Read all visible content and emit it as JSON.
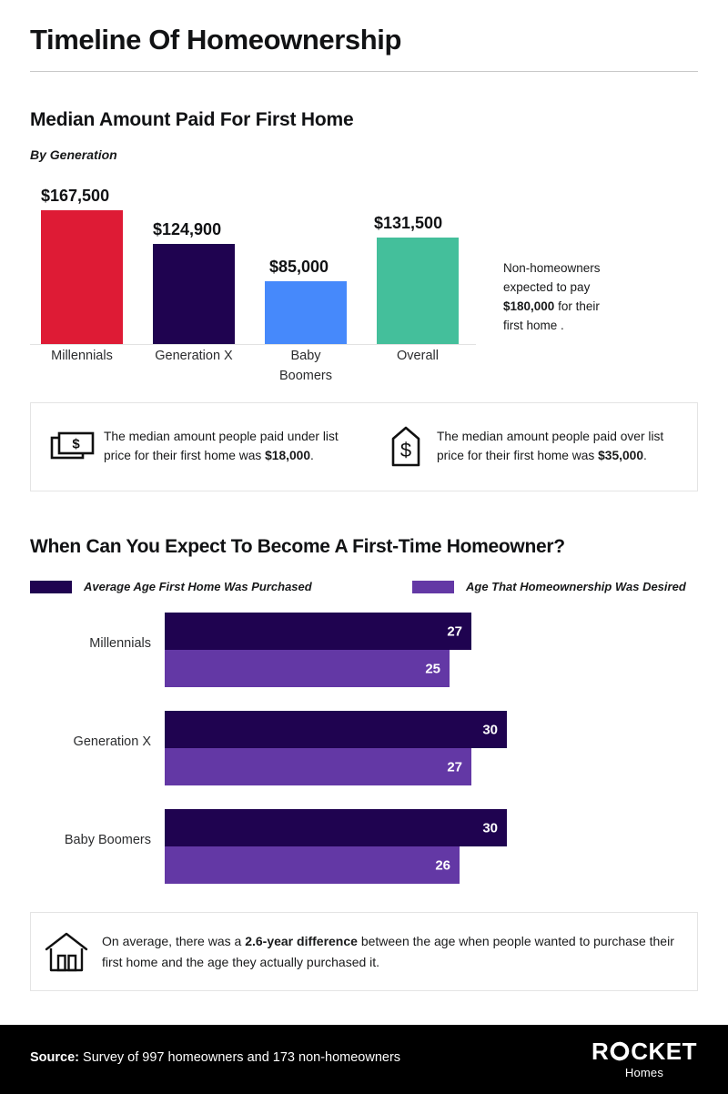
{
  "header": {
    "title": "Timeline Of Homeownership"
  },
  "section1": {
    "title": "Median Amount Paid For First Home",
    "subtitle": "By Generation",
    "side_note": {
      "line1": "Non-homeowners",
      "line2": "expected to pay",
      "amount": "$180,000",
      "line3": " for their",
      "line4": "first home ."
    }
  },
  "info_boxes": [
    {
      "icon": "cash-icon",
      "text_before": "The median amount people paid under list price for their first home was ",
      "amount": "$18,000",
      "text_after": "."
    },
    {
      "icon": "price-tag-icon",
      "text_before": "The median amount people paid over list price for their first home was ",
      "amount": "$35,000",
      "text_after": "."
    }
  ],
  "section2": {
    "title": "When Can You Expect To Become A First-Time Homeowner?"
  },
  "bottom_note": {
    "icon": "house-icon",
    "text_before": "On average, there was a ",
    "highlight": "2.6-year difference",
    "text_after": " between the age when people wanted to purchase their first home and the age they actually purchased it."
  },
  "footer": {
    "source_label": "Source:",
    "source_text": " Survey of 997 homeowners and 173 non-homeowners",
    "logo_main": "ROCKET",
    "logo_sub": "Homes"
  },
  "colors": {
    "red": "#DE1B35",
    "dark_purple": "#1F0350",
    "blue": "#4689FB",
    "teal": "#44BF9B",
    "mid_purple": "#6338A5",
    "black": "#000000",
    "rule": "#c9c9c9",
    "box_border": "#e4e4e4"
  },
  "chart_data": [
    {
      "type": "bar",
      "title": "Median Amount Paid For First Home",
      "subtitle": "By Generation",
      "xlabel": "",
      "ylabel": "",
      "ylim": [
        0,
        185000
      ],
      "grid": false,
      "legend": "none",
      "categories": [
        "Millennials",
        "Generation X",
        "Baby Boomers",
        "Overall"
      ],
      "values": [
        167500,
        124900,
        85000,
        131500
      ],
      "value_labels": [
        "$167,500",
        "$124,900",
        "$85,000",
        "$131,500"
      ],
      "bar_colors": [
        "#DE1B35",
        "#1F0350",
        "#4689FB",
        "#44BF9B"
      ],
      "annotation": "Non-homeowners expected to pay $180,000 for their first home ."
    },
    {
      "type": "bar",
      "orientation": "horizontal",
      "title": "When Can You Expect To Become A First-Time Homeowner?",
      "xlabel": "",
      "ylabel": "",
      "xlim": [
        0,
        34
      ],
      "grid": false,
      "legend": "top",
      "categories": [
        "Millennials",
        "Generation X",
        "Baby Boomers"
      ],
      "series": [
        {
          "name": "Average Age First Home Was Purchased",
          "color": "#1F0350",
          "values": [
            27,
            30,
            30
          ],
          "value_labels": [
            "27",
            "30",
            "30"
          ]
        },
        {
          "name": "Age That Homeownership Was Desired",
          "color": "#6338A5",
          "values": [
            25,
            27,
            26
          ],
          "value_labels": [
            "25",
            "27",
            "26"
          ]
        }
      ],
      "annotation": "On average, there was a 2.6-year difference between the age when people wanted to purchase their first home and the age they actually purchased it."
    }
  ]
}
